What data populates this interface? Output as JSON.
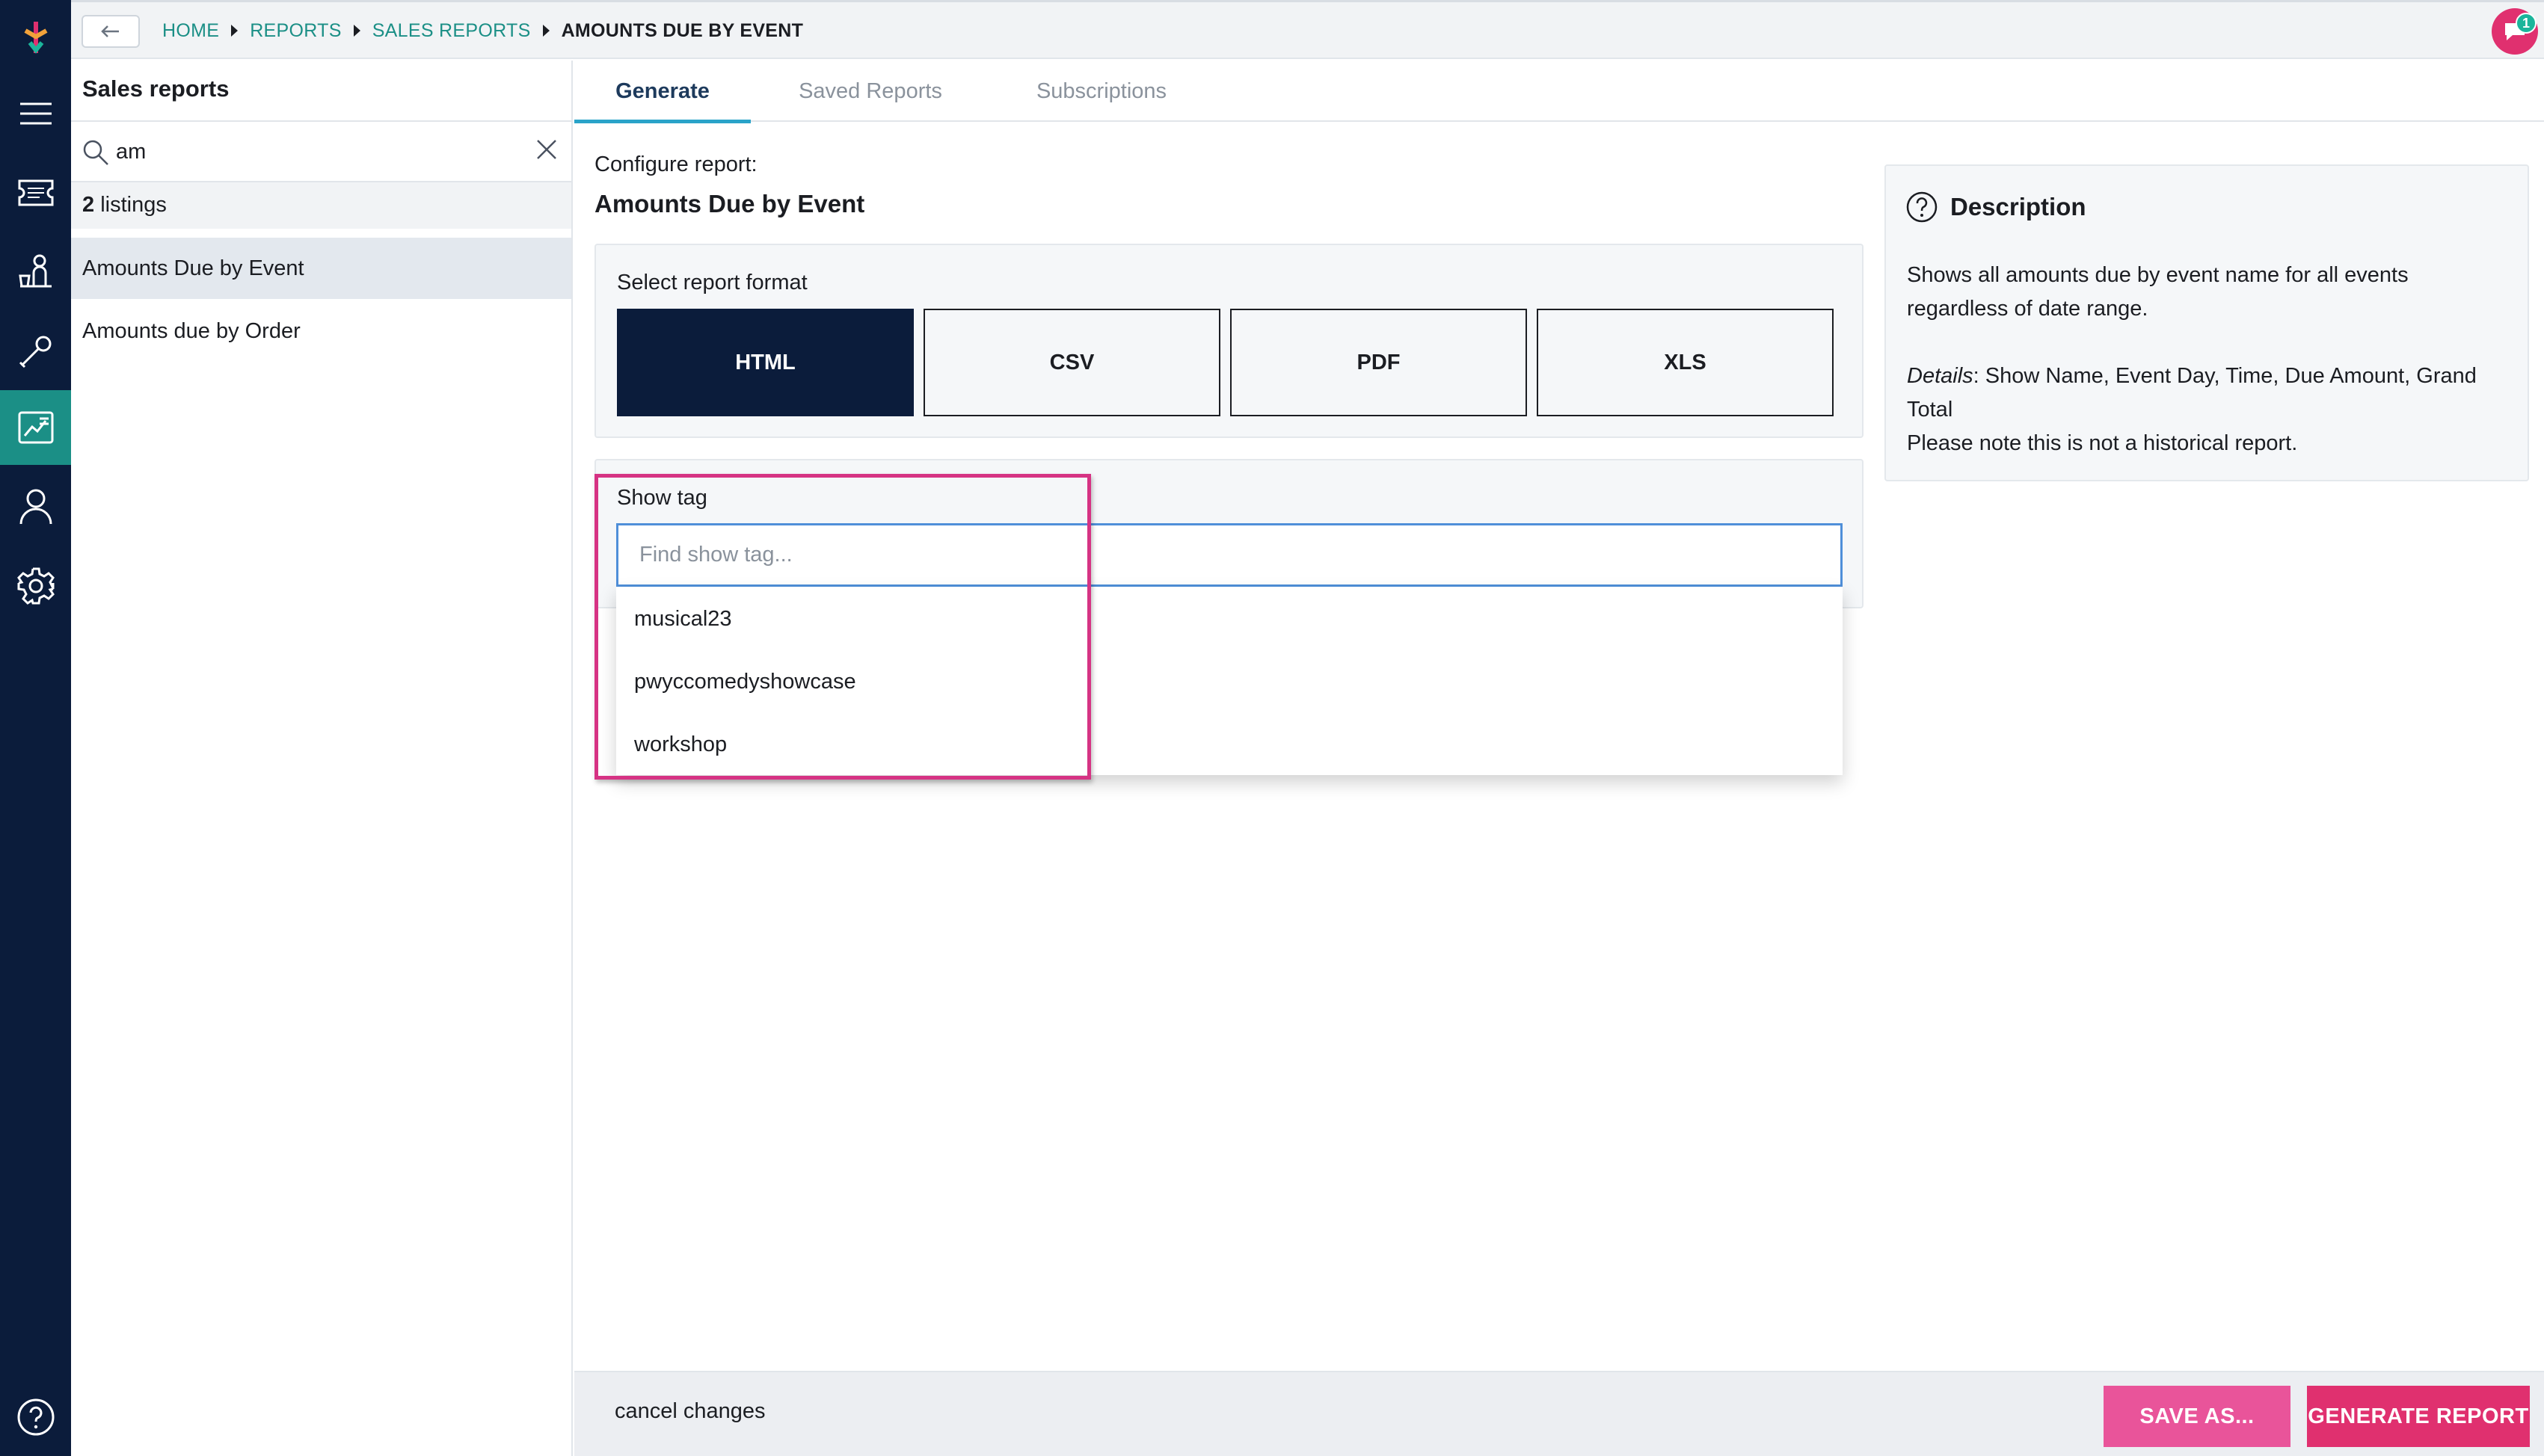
{
  "breadcrumb": {
    "items": [
      "HOME",
      "REPORTS",
      "SALES REPORTS"
    ],
    "current": "AMOUNTS DUE BY EVENT"
  },
  "notifications": {
    "count": "1"
  },
  "sidebar": {
    "title": "Sales reports",
    "search_value": "am",
    "listing_count": "2",
    "listing_label": "listings",
    "items": [
      {
        "label": "Amounts Due by Event",
        "selected": true
      },
      {
        "label": "Amounts due by Order",
        "selected": false
      }
    ]
  },
  "tabs": [
    {
      "label": "Generate",
      "active": true
    },
    {
      "label": "Saved Reports",
      "active": false
    },
    {
      "label": "Subscriptions",
      "active": false
    }
  ],
  "config": {
    "label": "Configure report:",
    "report_name": "Amounts Due by Event",
    "format_title": "Select report format",
    "formats": [
      {
        "label": "HTML",
        "active": true
      },
      {
        "label": "CSV",
        "active": false
      },
      {
        "label": "PDF",
        "active": false
      },
      {
        "label": "XLS",
        "active": false
      }
    ],
    "show_tag": {
      "title": "Show tag",
      "placeholder": "Find show tag...",
      "options": [
        "musical23",
        "pwyccomedyshowcase",
        "workshop"
      ]
    }
  },
  "description": {
    "title": "Description",
    "line1": "Shows all amounts due by event name for all events regardless of date range.",
    "details_label": "Details",
    "details_text": ": Show Name, Event Day, Time, Due Amount, Grand Total",
    "note": "Please note this is not a historical report."
  },
  "footer": {
    "cancel": "cancel changes",
    "save_as": "SAVE AS...",
    "generate": "GENERATE REPORT"
  },
  "colors": {
    "rail": "#0b1c3b",
    "accent_teal": "#1b8f86",
    "primary_pink": "#e0306f",
    "highlight": "#d63384",
    "active_format": "#0b1c3b"
  }
}
